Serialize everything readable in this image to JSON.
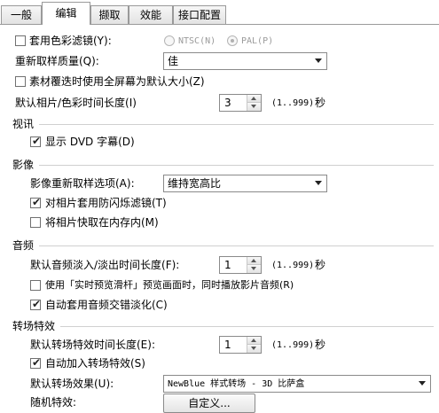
{
  "tabs": [
    "一般",
    "编辑",
    "撷取",
    "效能",
    "接口配置"
  ],
  "active_tab": "编辑",
  "color_filter": {
    "label": "套用色彩滤镜(Y):",
    "checked": false,
    "ntsc": "NTSC(N)",
    "pal": "PAL(P)"
  },
  "resample": {
    "label": "重新取样质量(Q):",
    "value": "佳"
  },
  "fullscreen": {
    "label": "素材覆迭时使用全屏幕为默认大小(Z)",
    "checked": false
  },
  "photo_duration": {
    "label": "默认相片/色彩时间长度(I)",
    "value": "3",
    "range": "(1..999)",
    "unit": "秒"
  },
  "video_section": "视讯",
  "dvd_subtitle": {
    "label": "显示 DVD 字幕(D)",
    "checked": true
  },
  "image_section": "影像",
  "image_resample": {
    "label": "影像重新取样选项(A):",
    "value": "维持宽高比"
  },
  "anti_flicker": {
    "label": "对相片套用防闪烁滤镜(T)",
    "checked": true
  },
  "cache_photo": {
    "label": "将相片快取在内存内(M)",
    "checked": false
  },
  "audio_section": "音频",
  "audio_fade": {
    "label": "默认音频淡入/淡出时间长度(F):",
    "value": "1",
    "range": "(1..999)",
    "unit": "秒"
  },
  "realtime_preview": {
    "label": "使用「实时预览滑杆」预览画面时，同时播放影片音频(R)",
    "checked": false
  },
  "auto_crossfade": {
    "label": "自动套用音频交错淡化(C)",
    "checked": true
  },
  "transition_section": "转场特效",
  "transition_duration": {
    "label": "默认转场特效时间长度(E):",
    "value": "1",
    "range": "(1..999)",
    "unit": "秒"
  },
  "auto_transition": {
    "label": "自动加入转场特效(S)",
    "checked": true
  },
  "default_transition": {
    "label": "默认转场效果(U):",
    "value": "NewBlue 样式转场 - 3D 比萨盒"
  },
  "random_effect": {
    "label": "随机特效:",
    "button": "自定义..."
  },
  "check_glyph": "✔"
}
